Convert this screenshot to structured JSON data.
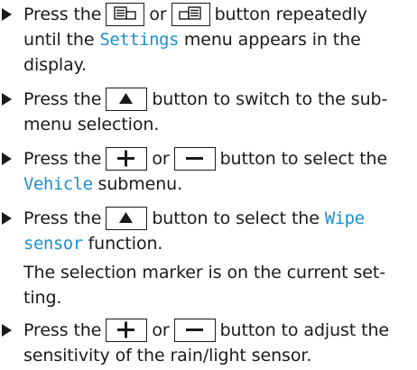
{
  "steps": [
    {
      "lines": [
        {
          "t1": "Press the",
          "t2": "or",
          "t3": "button repeatedly"
        },
        {
          "t1": "until the",
          "hl": "Settings",
          "t2": "menu appears in the"
        },
        {
          "t1": "display."
        }
      ]
    },
    {
      "lines": [
        {
          "t1": "Press the",
          "t2": "button to switch to the sub-"
        },
        {
          "t1": "menu selection."
        }
      ]
    },
    {
      "lines": [
        {
          "t1": "Press the",
          "t2": "or",
          "t3": "button to select the"
        },
        {
          "hl": "Vehicle",
          "t1": "submenu."
        }
      ]
    },
    {
      "lines": [
        {
          "t1": "Press the",
          "t2": "button to select the",
          "hl": "Wipe"
        },
        {
          "hl": "sensor",
          "t1": "function."
        },
        {
          "t1": "The selection marker is on the current set-"
        },
        {
          "t1": "ting."
        }
      ]
    },
    {
      "lines": [
        {
          "t1": "Press the",
          "t2": "or",
          "t3": "button to adjust the"
        },
        {
          "t1": "sensitivity of the rain/light sensor."
        }
      ]
    }
  ],
  "icons": {
    "key_prev": "display-back-icon",
    "key_next": "display-forward-icon",
    "key_up": "up-arrow-icon",
    "key_plus": "plus-icon",
    "key_minus": "minus-icon"
  },
  "colors": {
    "highlight": "#1e8fce",
    "text": "#1a1a1a"
  }
}
